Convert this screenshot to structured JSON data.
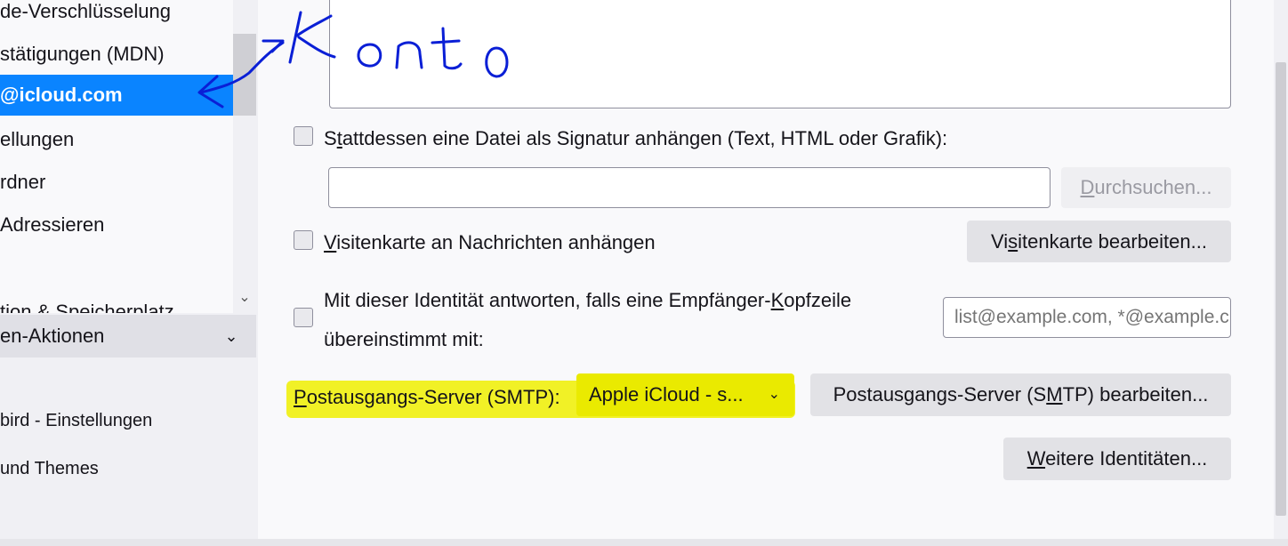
{
  "sidebar": {
    "tree_items": [
      {
        "label": "de-Verschlüsselung",
        "selected": false
      },
      {
        "label": "stätigungen (MDN)",
        "selected": false
      },
      {
        "label": "@icloud.com",
        "selected": true
      },
      {
        "label": "ellungen",
        "selected": false
      },
      {
        "label": "rdner",
        "selected": false
      },
      {
        "label": " Adressieren",
        "selected": false
      },
      {
        "label": "tion & Speicherplatz",
        "selected": false
      }
    ],
    "section_header": "en-Aktionen",
    "links": [
      {
        "label": "bird - Einstellungen"
      },
      {
        "label": " und Themes"
      }
    ]
  },
  "main": {
    "attach_file_signature": {
      "checked": false,
      "label_pre": "S",
      "label_u": "t",
      "label_post": "attdessen eine Datei als Signatur anhängen (Text, HTML oder Grafik):",
      "file_value": "",
      "browse_pre": "",
      "browse_u": "D",
      "browse_post": "urchsuchen..."
    },
    "vcard": {
      "checked": false,
      "label_pre": "",
      "label_u": "V",
      "label_post": "isitenkarte an Nachrichten anhängen",
      "edit_pre": "Vi",
      "edit_u": "s",
      "edit_post": "itenkarte bearbeiten..."
    },
    "reply_identity": {
      "checked": false,
      "line1_pre": "Mit dieser Identität antworten, falls eine Empfänger-",
      "line1_u": "K",
      "line1_post": "opfzeile",
      "line2": "übereinstimmt mit:",
      "placeholder": "list@example.com, *@example.com"
    },
    "smtp": {
      "label_pre": "",
      "label_u": "P",
      "label_post": "ostausgangs-Server (SMTP):",
      "selected": "Apple iCloud - s...",
      "edit_pre": "Postausgangs-Server (S",
      "edit_u": "M",
      "edit_post": "TP) bearbeiten..."
    },
    "more_identities": {
      "pre": "",
      "u": "W",
      "post": "eitere Identitäten..."
    }
  },
  "colors": {
    "selected": "#0a84ff",
    "highlight": "#eaea00",
    "annotation_ink": "#0a1fd6"
  },
  "icons": {
    "tree_scroll_down": "chevron-down-icon",
    "section_toggle": "chevron-down-icon",
    "select_arrow": "chevron-down-icon"
  }
}
